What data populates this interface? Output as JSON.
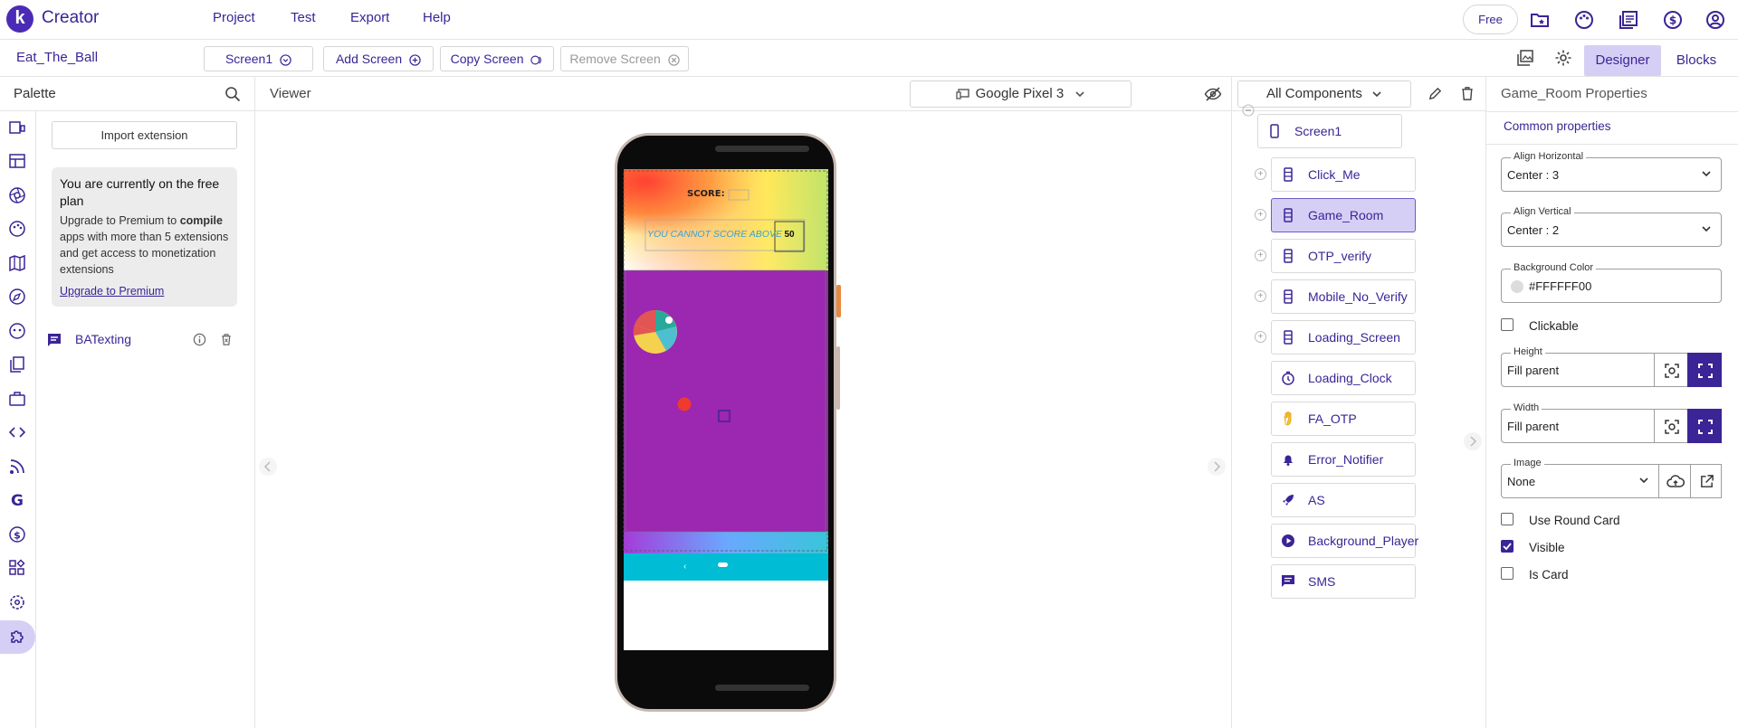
{
  "app": {
    "brand": "Creator",
    "logo_letter": "k"
  },
  "menu": [
    "Project",
    "Test",
    "Export",
    "Help"
  ],
  "plan_badge": "Free",
  "toolbar": {
    "project_name": "Eat_The_Ball",
    "screen_select": "Screen1",
    "add_screen": "Add Screen",
    "copy_screen": "Copy Screen",
    "remove_screen": "Remove Screen",
    "designer": "Designer",
    "blocks": "Blocks"
  },
  "palette": {
    "title": "Palette",
    "import_extension": "Import extension",
    "free_plan": {
      "heading": "You are currently on the free plan",
      "body_prefix": "Upgrade to Premium to ",
      "body_bold": "compile",
      "body_suffix": " apps with more than 5 extensions and get access to monetization extensions",
      "link": "Upgrade to Premium"
    },
    "extension_name": "BATexting"
  },
  "viewer": {
    "title": "Viewer",
    "device": "Google Pixel 3",
    "phone": {
      "score_label": "SCORE:",
      "limit_label": "YOU CANNOT SCORE ABOVE",
      "limit_value": "50",
      "nav_back": "‹"
    }
  },
  "components": {
    "filter": "All Components",
    "root": "Screen1",
    "items": [
      {
        "name": "Click_Me",
        "icon": "arrangement-icon",
        "expandable": true
      },
      {
        "name": "Game_Room",
        "icon": "arrangement-icon",
        "expandable": true,
        "selected": true
      },
      {
        "name": "OTP_verify",
        "icon": "arrangement-icon",
        "expandable": true
      },
      {
        "name": "Mobile_No_Verify",
        "icon": "arrangement-icon",
        "expandable": true
      },
      {
        "name": "Loading_Screen",
        "icon": "arrangement-icon",
        "expandable": true
      },
      {
        "name": "Loading_Clock",
        "icon": "clock-icon",
        "expandable": false
      },
      {
        "name": "FA_OTP",
        "icon": "hand-icon",
        "expandable": false
      },
      {
        "name": "Error_Notifier",
        "icon": "bell-icon",
        "expandable": false
      },
      {
        "name": "AS",
        "icon": "rocket-icon",
        "expandable": false
      },
      {
        "name": "Background_Player",
        "icon": "play-icon",
        "expandable": false
      },
      {
        "name": "SMS",
        "icon": "message-icon",
        "expandable": false
      }
    ]
  },
  "properties": {
    "title": "Game_Room Properties",
    "section": "Common properties",
    "align_horizontal": {
      "label": "Align Horizontal",
      "value": "Center : 3"
    },
    "align_vertical": {
      "label": "Align Vertical",
      "value": "Center : 2"
    },
    "background_color": {
      "label": "Background Color",
      "value": "#FFFFFF00"
    },
    "clickable": {
      "label": "Clickable",
      "checked": false
    },
    "height": {
      "label": "Height",
      "value": "Fill parent"
    },
    "width": {
      "label": "Width",
      "value": "Fill parent"
    },
    "image": {
      "label": "Image",
      "value": "None"
    },
    "use_round_card": {
      "label": "Use Round Card",
      "checked": false
    },
    "visible": {
      "label": "Visible",
      "checked": true
    },
    "is_card": {
      "label": "Is Card",
      "checked": false
    }
  },
  "colors": {
    "accent": "#3b2496",
    "selected_bg": "#d6cff5",
    "game_room_bg": "#9c27b0",
    "nav_bar": "#00bcd4"
  }
}
